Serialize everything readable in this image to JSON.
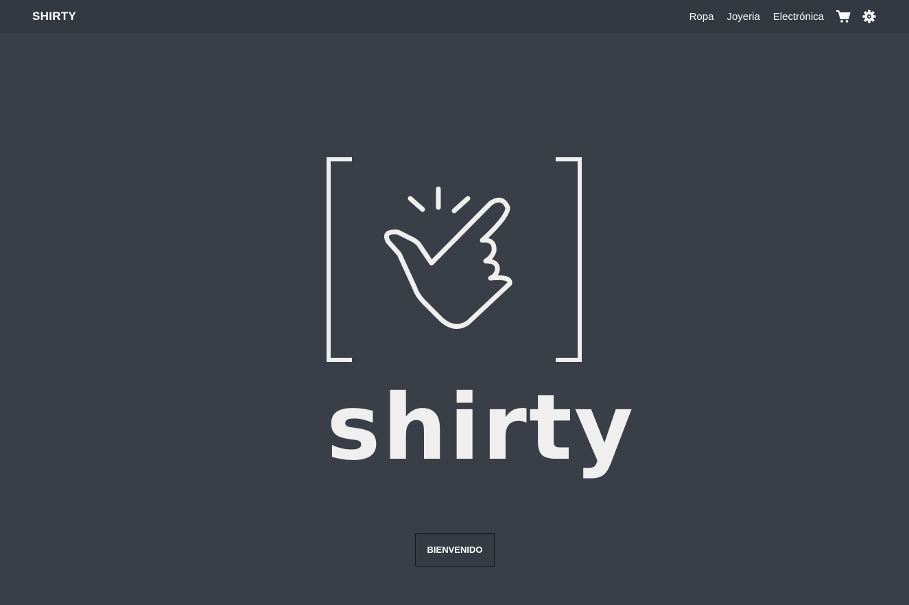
{
  "navbar": {
    "brand": "SHIRTY",
    "links": [
      "Ropa",
      "Joyeria",
      "Electrónica"
    ],
    "icons": [
      "cart-icon",
      "settings-gear-icon"
    ]
  },
  "hero": {
    "logo_icon": "snap-fingers-icon",
    "logo_text": "shirty",
    "button_label": "BIENVENIDO"
  },
  "colors": {
    "background": "#3a3e47",
    "navbar": "#343841",
    "logo": "#efefef",
    "text": "#ffffff"
  }
}
